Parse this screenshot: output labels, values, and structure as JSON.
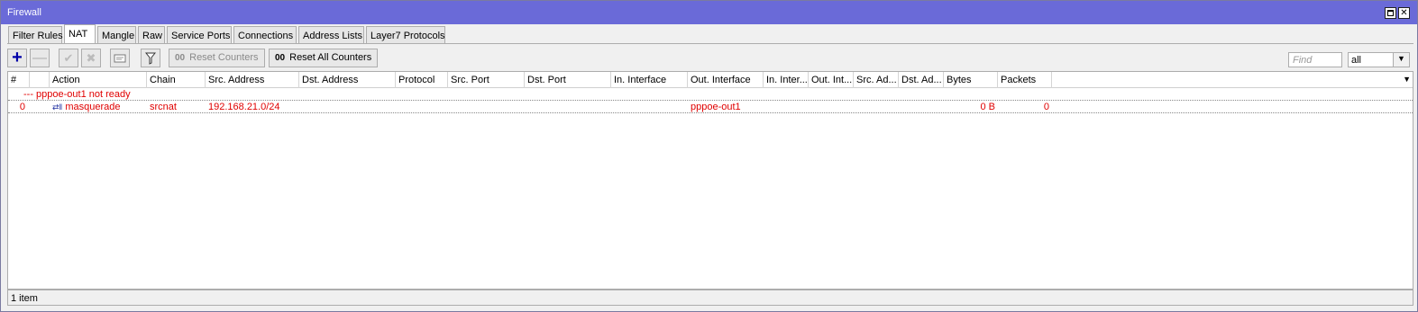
{
  "window": {
    "title": "Firewall"
  },
  "tabs": [
    "Filter Rules",
    "NAT",
    "Mangle",
    "Raw",
    "Service Ports",
    "Connections",
    "Address Lists",
    "Layer7 Protocols"
  ],
  "active_tab": "NAT",
  "toolbar": {
    "reset_counters_prefix": "00",
    "reset_counters": "Reset Counters",
    "reset_all_counters_prefix": "00",
    "reset_all_counters": "Reset All Counters",
    "find_placeholder": "Find",
    "filter_value": "all",
    "icons": [
      "add-icon",
      "remove-icon",
      "enable-icon",
      "disable-icon",
      "comment-icon",
      "filter-icon"
    ]
  },
  "table": {
    "columns": [
      "#",
      "",
      "Action",
      "Chain",
      "Src. Address",
      "Dst. Address",
      "Protocol",
      "Src. Port",
      "Dst. Port",
      "In. Interface",
      "Out. Interface",
      "In. Inter...",
      "Out. Int...",
      "Src. Ad...",
      "Dst. Ad...",
      "Bytes",
      "Packets"
    ],
    "comment": "--- pppoe-out1 not ready",
    "rows": [
      {
        "num": "0",
        "action": "masquerade",
        "chain": "srcnat",
        "src_address": "192.168.21.0/24",
        "dst_address": "",
        "protocol": "",
        "src_port": "",
        "dst_port": "",
        "in_interface": "",
        "out_interface": "pppoe-out1",
        "bytes": "0 B",
        "packets": "0"
      }
    ],
    "row_color": "#e00000"
  },
  "status": {
    "items": "1 item"
  }
}
